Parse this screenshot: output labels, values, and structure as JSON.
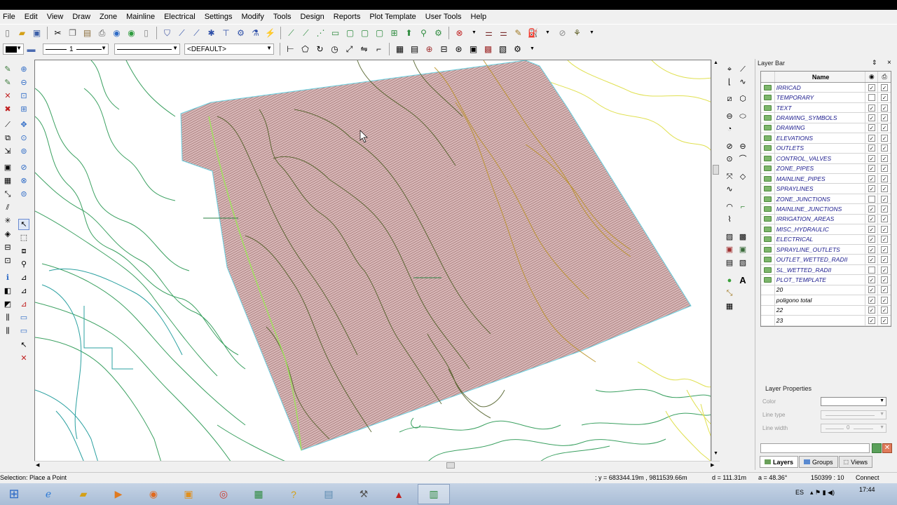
{
  "menu": [
    "File",
    "Edit",
    "View",
    "Draw",
    "Zone",
    "Mainline",
    "Electrical",
    "Settings",
    "Modify",
    "Tools",
    "Design",
    "Reports",
    "Plot Template",
    "User Tools",
    "Help"
  ],
  "toolbar2": {
    "line_weight_value": "1",
    "layer_dropdown_value": "<DEFAULT>"
  },
  "layer_bar": {
    "title": "Layer Bar",
    "pin": "⇕",
    "close": "×",
    "name_header": "Name",
    "layers": [
      {
        "name": "IRRICAD",
        "visible": true,
        "print": true,
        "icon": true
      },
      {
        "name": "TEMPORARY",
        "visible": false,
        "print": true,
        "icon": true
      },
      {
        "name": "TEXT",
        "visible": true,
        "print": true,
        "icon": true
      },
      {
        "name": "DRAWING_SYMBOLS",
        "visible": true,
        "print": true,
        "icon": true
      },
      {
        "name": "DRAWING",
        "visible": true,
        "print": true,
        "icon": true
      },
      {
        "name": "ELEVATIONS",
        "visible": true,
        "print": true,
        "icon": true
      },
      {
        "name": "OUTLETS",
        "visible": true,
        "print": true,
        "icon": true
      },
      {
        "name": "CONTROL_VALVES",
        "visible": true,
        "print": true,
        "icon": true
      },
      {
        "name": "ZONE_PIPES",
        "visible": true,
        "print": true,
        "icon": true
      },
      {
        "name": "MAINLINE_PIPES",
        "visible": true,
        "print": true,
        "icon": true
      },
      {
        "name": "SPRAYLINES",
        "visible": true,
        "print": true,
        "icon": true
      },
      {
        "name": "ZONE_JUNCTIONS",
        "visible": false,
        "print": true,
        "icon": true
      },
      {
        "name": "MAINLINE_JUNCTIONS",
        "visible": true,
        "print": true,
        "icon": true
      },
      {
        "name": "IRRIGATION_AREAS",
        "visible": true,
        "print": true,
        "icon": true
      },
      {
        "name": "MISC_HYDRAULIC",
        "visible": true,
        "print": true,
        "icon": true
      },
      {
        "name": "ELECTRICAL",
        "visible": true,
        "print": true,
        "icon": true
      },
      {
        "name": "SPRAYLINE_OUTLETS",
        "visible": true,
        "print": true,
        "icon": true
      },
      {
        "name": "OUTLET_WETTED_RADII",
        "visible": true,
        "print": true,
        "icon": true
      },
      {
        "name": "SL_WETTED_RADII",
        "visible": false,
        "print": true,
        "icon": true
      },
      {
        "name": "PLOT_TEMPLATE",
        "visible": true,
        "print": true,
        "icon": true
      },
      {
        "name": "20",
        "visible": true,
        "print": true,
        "icon": false
      },
      {
        "name": "poligono total",
        "visible": true,
        "print": true,
        "icon": false
      },
      {
        "name": "22",
        "visible": true,
        "print": true,
        "icon": false
      },
      {
        "name": "23",
        "visible": true,
        "print": true,
        "icon": false
      }
    ],
    "properties": {
      "title": "Layer Properties",
      "color_label": "Color",
      "line_type_label": "Line type",
      "line_width_label": "Line width",
      "line_width_value": "0"
    },
    "tabs": [
      "Layers",
      "Groups",
      "Views"
    ]
  },
  "status": {
    "prompt": "Selection: Place a Point",
    "coords": "; y = 683344.19m ,  9811539.66m",
    "distance": "d = 111.31m",
    "angle": "a = 48.36°",
    "scale": "150399 : 10",
    "connect": "Connect"
  },
  "taskbar": {
    "lang": "ES",
    "time": "17:44"
  }
}
